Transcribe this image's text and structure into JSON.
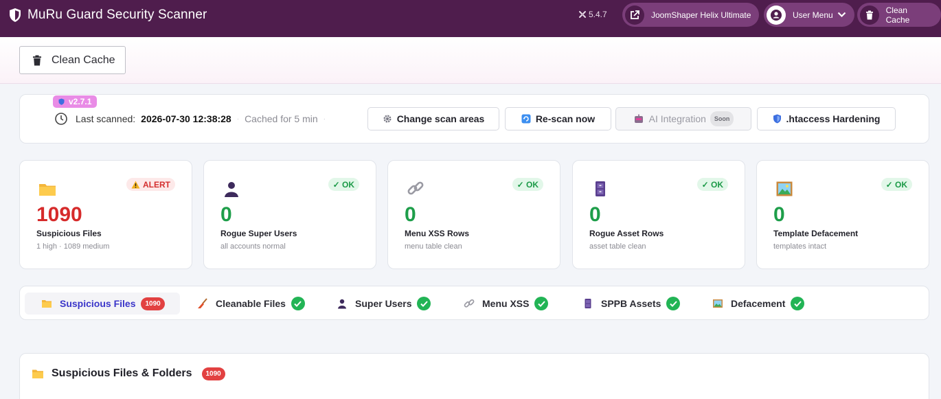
{
  "header": {
    "title": "MuRu Guard Security Scanner",
    "joomla_version": "5.4.7",
    "links": [
      {
        "label": "JoomShaper Helix Ultimate",
        "icon": "external-link-icon"
      },
      {
        "label": "User Menu",
        "icon": "user-circle-icon"
      },
      {
        "label": "Clean Cache",
        "icon": "trash-icon"
      }
    ]
  },
  "toolbar": {
    "clean_cache_label": "Clean Cache"
  },
  "scan_info": {
    "version_badge": "v2.7.1",
    "last_scanned_label": "Last scanned:",
    "last_scanned_value": "2026-07-30 12:38:28",
    "cached_text": "Cached for 5 min",
    "actions": [
      {
        "label": "Change scan areas",
        "icon": "gear-icon"
      },
      {
        "label": "Re-scan now",
        "icon": "refresh-icon"
      },
      {
        "label": "AI Integration",
        "icon": "robot-icon",
        "tag": "Soon",
        "disabled": true
      },
      {
        "label": ".htaccess Hardening",
        "icon": "shield-icon"
      }
    ]
  },
  "stats": [
    {
      "icon": "folder-icon",
      "badge": "ALERT",
      "badge_type": "alert",
      "value": "1090",
      "label": "Suspicious Files",
      "sub": "1 high · 1089 medium"
    },
    {
      "icon": "user-icon",
      "badge": "OK",
      "badge_type": "ok",
      "value": "0",
      "label": "Rogue Super Users",
      "sub": "all accounts normal"
    },
    {
      "icon": "link-icon",
      "badge": "OK",
      "badge_type": "ok",
      "value": "0",
      "label": "Menu XSS Rows",
      "sub": "menu table clean"
    },
    {
      "icon": "cabinet-icon",
      "badge": "OK",
      "badge_type": "ok",
      "value": "0",
      "label": "Rogue Asset Rows",
      "sub": "asset table clean"
    },
    {
      "icon": "picture-icon",
      "badge": "OK",
      "badge_type": "ok",
      "value": "0",
      "label": "Template Defacement",
      "sub": "templates intact"
    }
  ],
  "tabs": [
    {
      "label": "Suspicious Files",
      "icon": "folder-icon",
      "count": "1090",
      "active": true
    },
    {
      "label": "Cleanable Files",
      "icon": "broom-icon",
      "status": "ok"
    },
    {
      "label": "Super Users",
      "icon": "user-icon",
      "status": "ok"
    },
    {
      "label": "Menu XSS",
      "icon": "link-icon",
      "status": "ok"
    },
    {
      "label": "SPPB Assets",
      "icon": "cabinet-icon",
      "status": "ok"
    },
    {
      "label": "Defacement",
      "icon": "picture-icon",
      "status": "ok"
    }
  ],
  "section": {
    "title": "Suspicious Files & Folders",
    "count": "1090"
  },
  "colors": {
    "header_bg": "#4f1d4d",
    "header_pill": "#7b3e7a",
    "alert_red": "#d62b2b",
    "ok_green": "#1e9e4a",
    "active_tab": "#3a35c9",
    "version_badge": "#e98ce6"
  }
}
